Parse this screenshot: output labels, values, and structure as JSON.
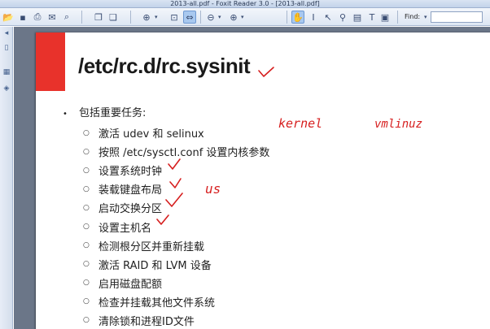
{
  "window": {
    "title": "2013-all.pdf - Foxit Reader 3.0 - [2013-all.pdf]"
  },
  "toolbar": {
    "find_label": "Find:",
    "find_value": ""
  },
  "slide": {
    "title": "/etc/rc.d/rc.sysinit",
    "main_bullet": "包括重要任务:",
    "items": [
      "激活 udev 和 selinux",
      "按照 /etc/sysctl.conf 设置内核参数",
      "设置系统时钟",
      "装载键盘布局",
      "启动交换分区",
      "设置主机名",
      "检测根分区并重新挂载",
      "激活 RAID 和 LVM 设备",
      "启用磁盘配额",
      "检查并挂载其他文件系统",
      "清除锁和进程ID文件"
    ]
  },
  "annotations": {
    "kernel": "kernel",
    "vmlinuz": "vmlinuz",
    "us": "us",
    "ink_color": "#d61e1e"
  },
  "colors": {
    "accent_red": "#e8322b",
    "doc_background": "#6b7688"
  }
}
